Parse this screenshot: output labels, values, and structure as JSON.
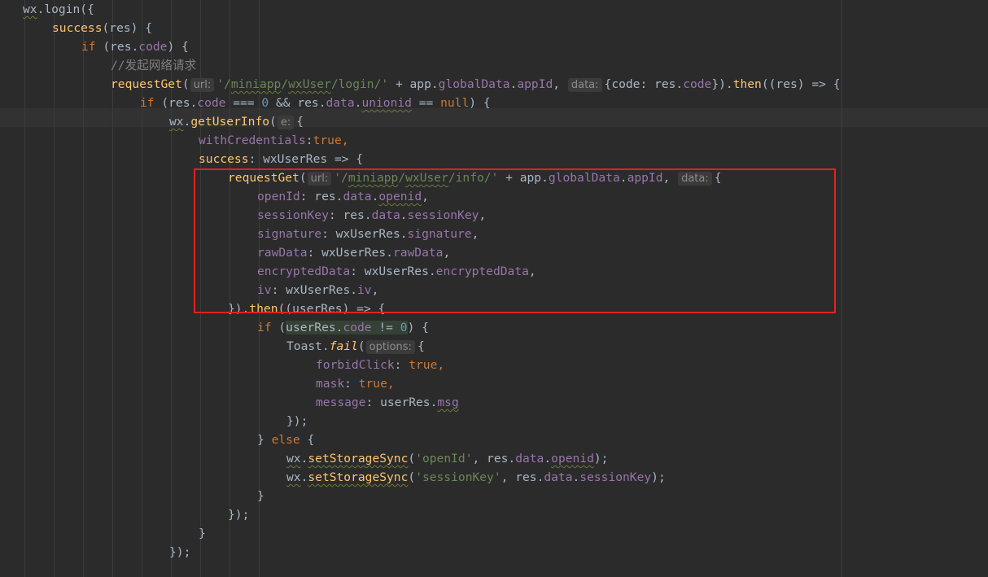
{
  "editor": {
    "lines": [
      {
        "indent": 0,
        "tokens": [
          {
            "t": "wx",
            "c": "sq"
          },
          {
            "t": ".login({"
          }
        ]
      },
      {
        "indent": 1,
        "tokens": [
          {
            "t": "success",
            "c": "fn"
          },
          {
            "t": "(res) {"
          }
        ]
      },
      {
        "indent": 2,
        "tokens": [
          {
            "t": "if",
            "c": "kw"
          },
          {
            "t": " (res."
          },
          {
            "t": "code",
            "c": "prop"
          },
          {
            "t": ") {"
          }
        ]
      },
      {
        "indent": 3,
        "tokens": [
          {
            "t": "//发起网络请求",
            "c": "cmt"
          }
        ]
      },
      {
        "indent": 3,
        "tokens": [
          {
            "t": "requestGet",
            "c": "fn"
          },
          {
            "t": "("
          },
          {
            "hint": "url:"
          },
          {
            "t": "'/",
            "c": "str"
          },
          {
            "t": "miniapp",
            "c": "str sq"
          },
          {
            "t": "/",
            "c": "str"
          },
          {
            "t": "wxUser",
            "c": "str sq"
          },
          {
            "t": "/login/'",
            "c": "str"
          },
          {
            "t": " + app."
          },
          {
            "t": "globalData",
            "c": "prop"
          },
          {
            "t": "."
          },
          {
            "t": "appId",
            "c": "prop"
          },
          {
            "t": ", "
          },
          {
            "hint": "data:"
          },
          {
            "t": "{code: res."
          },
          {
            "t": "code",
            "c": "prop"
          },
          {
            "t": "})."
          },
          {
            "t": "then",
            "c": "fn"
          },
          {
            "t": "((res) => {"
          }
        ]
      },
      {
        "indent": 4,
        "tokens": [
          {
            "t": "if",
            "c": "kw"
          },
          {
            "t": " (res."
          },
          {
            "t": "code",
            "c": "prop"
          },
          {
            "t": " === "
          },
          {
            "t": "0",
            "c": "num"
          },
          {
            "t": " && res."
          },
          {
            "t": "data",
            "c": "prop"
          },
          {
            "t": "."
          },
          {
            "t": "unionid",
            "c": "prop sq"
          },
          {
            "t": " == "
          },
          {
            "t": "null",
            "c": "kw"
          },
          {
            "t": ") {"
          }
        ]
      },
      {
        "indent": 5,
        "current": true,
        "tokens": [
          {
            "t": "wx",
            "c": "sq"
          },
          {
            "t": "."
          },
          {
            "t": "getUserInfo",
            "c": "fn"
          },
          {
            "t": "("
          },
          {
            "hint": "e:"
          },
          {
            "t": "{"
          }
        ]
      },
      {
        "indent": 6,
        "tokens": [
          {
            "t": "withCredentials",
            "c": "prop"
          },
          {
            "t": ":"
          },
          {
            "t": "true",
            "c": "kw"
          },
          {
            "t": ",",
            "c": "kw"
          }
        ]
      },
      {
        "indent": 6,
        "tokens": [
          {
            "t": "success",
            "c": "fn"
          },
          {
            "t": ": wxUserRes => {"
          }
        ]
      },
      {
        "indent": 7,
        "tokens": [
          {
            "t": "requestGet",
            "c": "fn"
          },
          {
            "t": "("
          },
          {
            "hint": "url:"
          },
          {
            "t": "'/",
            "c": "str"
          },
          {
            "t": "miniapp",
            "c": "str sq"
          },
          {
            "t": "/",
            "c": "str"
          },
          {
            "t": "wxUser",
            "c": "str sq"
          },
          {
            "t": "/info/'",
            "c": "str"
          },
          {
            "t": " + app."
          },
          {
            "t": "globalData",
            "c": "prop"
          },
          {
            "t": "."
          },
          {
            "t": "appId",
            "c": "prop"
          },
          {
            "t": ", "
          },
          {
            "hint": "data:"
          },
          {
            "t": "{"
          }
        ]
      },
      {
        "indent": 8,
        "tokens": [
          {
            "t": "openId",
            "c": "prop"
          },
          {
            "t": ": res."
          },
          {
            "t": "data",
            "c": "prop"
          },
          {
            "t": "."
          },
          {
            "t": "openid",
            "c": "prop sq"
          },
          {
            "t": ","
          }
        ]
      },
      {
        "indent": 8,
        "tokens": [
          {
            "t": "sessionKey",
            "c": "prop"
          },
          {
            "t": ": res."
          },
          {
            "t": "data",
            "c": "prop"
          },
          {
            "t": "."
          },
          {
            "t": "sessionKey",
            "c": "prop"
          },
          {
            "t": ","
          }
        ]
      },
      {
        "indent": 8,
        "tokens": [
          {
            "t": "signature",
            "c": "prop"
          },
          {
            "t": ": wxUserRes."
          },
          {
            "t": "signature",
            "c": "prop"
          },
          {
            "t": ","
          }
        ]
      },
      {
        "indent": 8,
        "tokens": [
          {
            "t": "rawData",
            "c": "prop"
          },
          {
            "t": ": wxUserRes."
          },
          {
            "t": "rawData",
            "c": "prop"
          },
          {
            "t": ","
          }
        ]
      },
      {
        "indent": 8,
        "tokens": [
          {
            "t": "encryptedData",
            "c": "prop"
          },
          {
            "t": ": wxUserRes."
          },
          {
            "t": "encryptedData",
            "c": "prop"
          },
          {
            "t": ","
          }
        ]
      },
      {
        "indent": 8,
        "tokens": [
          {
            "t": "iv",
            "c": "prop"
          },
          {
            "t": ": wxUserRes."
          },
          {
            "t": "iv",
            "c": "prop"
          },
          {
            "t": ","
          }
        ]
      },
      {
        "indent": 7,
        "tokens": [
          {
            "t": "})."
          },
          {
            "t": "then",
            "c": "fn"
          },
          {
            "t": "((userRes) => {"
          }
        ]
      },
      {
        "indent": 8,
        "tokens": [
          {
            "t": "if",
            "c": "kw"
          },
          {
            "t": " ("
          },
          {
            "t": "userRes.",
            "c": "hl"
          },
          {
            "t": "code",
            "c": "prop hl"
          },
          {
            "t": " != ",
            "c": "hl"
          },
          {
            "t": "0",
            "c": "num hl"
          },
          {
            "t": ") {"
          }
        ]
      },
      {
        "indent": 9,
        "tokens": [
          {
            "t": "Toast."
          },
          {
            "t": "fail",
            "c": "fn ital"
          },
          {
            "t": "("
          },
          {
            "hint": "options:"
          },
          {
            "t": "{"
          }
        ]
      },
      {
        "indent": 10,
        "tokens": [
          {
            "t": "forbidClick",
            "c": "prop"
          },
          {
            "t": ": "
          },
          {
            "t": "true",
            "c": "kw"
          },
          {
            "t": ",",
            "c": "kw"
          }
        ]
      },
      {
        "indent": 10,
        "tokens": [
          {
            "t": "mask",
            "c": "prop"
          },
          {
            "t": ": "
          },
          {
            "t": "true",
            "c": "kw"
          },
          {
            "t": ",",
            "c": "kw"
          }
        ]
      },
      {
        "indent": 10,
        "tokens": [
          {
            "t": "message",
            "c": "prop"
          },
          {
            "t": ": userRes."
          },
          {
            "t": "msg",
            "c": "prop sq"
          }
        ]
      },
      {
        "indent": 9,
        "tokens": [
          {
            "t": "});"
          }
        ]
      },
      {
        "indent": 8,
        "tokens": [
          {
            "t": "} "
          },
          {
            "t": "else",
            "c": "kw"
          },
          {
            "t": " {"
          }
        ]
      },
      {
        "indent": 9,
        "tokens": [
          {
            "t": "wx",
            "c": "sq"
          },
          {
            "t": "."
          },
          {
            "t": "setStorageSync",
            "c": "fn sq"
          },
          {
            "t": "("
          },
          {
            "t": "'openId'",
            "c": "str"
          },
          {
            "t": ", res."
          },
          {
            "t": "data",
            "c": "prop"
          },
          {
            "t": "."
          },
          {
            "t": "openid",
            "c": "prop sq"
          },
          {
            "t": ");"
          }
        ]
      },
      {
        "indent": 9,
        "tokens": [
          {
            "t": "wx",
            "c": "sq"
          },
          {
            "t": "."
          },
          {
            "t": "setStorageSync",
            "c": "fn sq"
          },
          {
            "t": "("
          },
          {
            "t": "'sessionKey'",
            "c": "str"
          },
          {
            "t": ", res."
          },
          {
            "t": "data",
            "c": "prop"
          },
          {
            "t": "."
          },
          {
            "t": "sessionKey",
            "c": "prop"
          },
          {
            "t": ");"
          }
        ]
      },
      {
        "indent": 8,
        "tokens": [
          {
            "t": "}"
          }
        ]
      },
      {
        "indent": 7,
        "tokens": [
          {
            "t": "});"
          }
        ]
      },
      {
        "indent": 6,
        "tokens": [
          {
            "t": "}"
          }
        ]
      },
      {
        "indent": 5,
        "tokens": [
          {
            "t": "});"
          }
        ]
      }
    ]
  },
  "colors": {
    "background": "#2b2b2b",
    "text": "#a9b7c6",
    "keyword": "#cc7832",
    "function": "#ffc66d",
    "property": "#9876aa",
    "string": "#6a8759",
    "number": "#6897bb",
    "comment": "#808080",
    "annotation_box": "#e0231f"
  }
}
